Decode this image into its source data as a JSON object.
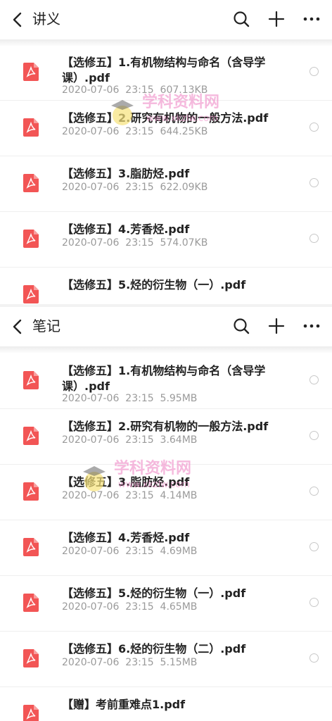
{
  "panels": [
    {
      "title": "讲义",
      "files": [
        {
          "name": "【选修五】1.有机物结构与命名（含导学课）.pdf",
          "date": "2020-07-06",
          "time": "23:15",
          "size": "607.13KB"
        },
        {
          "name": "【选修五】2.研究有机物的一般方法.pdf",
          "date": "2020-07-06",
          "time": "23:15",
          "size": "644.25KB"
        },
        {
          "name": "【选修五】3.脂肪烃.pdf",
          "date": "2020-07-06",
          "time": "23:15",
          "size": "622.09KB"
        },
        {
          "name": "【选修五】4.芳香烃.pdf",
          "date": "2020-07-06",
          "time": "23:15",
          "size": "574.07KB"
        },
        {
          "name": "【选修五】5.烃的衍生物（一）.pdf",
          "date": "",
          "time": "",
          "size": ""
        }
      ]
    },
    {
      "title": "笔记",
      "files": [
        {
          "name": "【选修五】1.有机物结构与命名（含导学课）.pdf",
          "date": "2020-07-06",
          "time": "23:15",
          "size": "5.95MB"
        },
        {
          "name": "【选修五】2.研究有机物的一般方法.pdf",
          "date": "2020-07-06",
          "time": "23:15",
          "size": "3.64MB"
        },
        {
          "name": "【选修五】3.脂肪烃.pdf",
          "date": "2020-07-06",
          "time": "23:15",
          "size": "4.14MB"
        },
        {
          "name": "【选修五】4.芳香烃.pdf",
          "date": "2020-07-06",
          "time": "23:15",
          "size": "4.69MB"
        },
        {
          "name": "【选修五】5.烃的衍生物（一）.pdf",
          "date": "2020-07-06",
          "time": "23:15",
          "size": "4.65MB"
        },
        {
          "name": "【选修五】6.烃的衍生物（二）.pdf",
          "date": "2020-07-06",
          "time": "23:15",
          "size": "5.15MB"
        },
        {
          "name": "【赠】考前重难点1.pdf",
          "date": "",
          "time": "",
          "size": ""
        }
      ]
    }
  ],
  "icons": {
    "back": "back-arrow-icon",
    "search": "search-icon",
    "add": "plus-icon",
    "more": "more-dots-icon",
    "file": "pdf-file-icon",
    "select": "radio-circle-icon"
  },
  "colors": {
    "pdf_red": "#f25555",
    "meta_gray": "#9a9a9a",
    "watermark_pink": "#f08bc8"
  },
  "watermark": {
    "main": "学科资料网",
    "url": "www.xkzlw.com"
  }
}
